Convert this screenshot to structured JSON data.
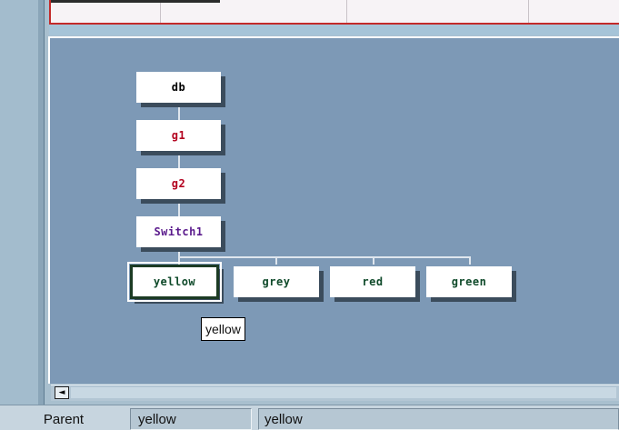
{
  "tree": {
    "nodes": [
      {
        "id": "db",
        "label": "db",
        "color": "#000000"
      },
      {
        "id": "g1",
        "label": "g1",
        "color": "#b3001e"
      },
      {
        "id": "g2",
        "label": "g2",
        "color": "#b3001e"
      },
      {
        "id": "switch1",
        "label": "Switch1",
        "color": "#5a1a8c"
      },
      {
        "id": "yellow",
        "label": "yellow",
        "color": "#0f4a2a",
        "selected": true
      },
      {
        "id": "grey",
        "label": "grey",
        "color": "#0f4a2a"
      },
      {
        "id": "red",
        "label": "red",
        "color": "#0f4a2a"
      },
      {
        "id": "green",
        "label": "green",
        "color": "#0f4a2a"
      }
    ]
  },
  "tooltip": {
    "text": "yellow"
  },
  "scrollbar": {
    "left_arrow": "◄"
  },
  "status_bar": {
    "label": "Parent",
    "value1": "yellow",
    "value2": "yellow"
  }
}
